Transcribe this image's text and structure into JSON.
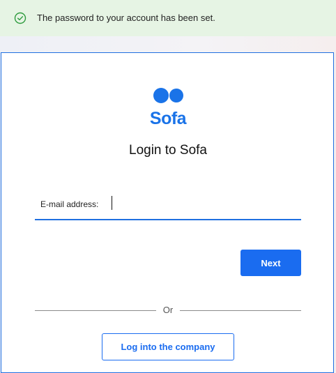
{
  "notification": {
    "icon": "check-circle-icon",
    "message": "The password to your account has been set.",
    "color": "#2e9b3e",
    "background": "#e6f4e4"
  },
  "brand": {
    "name": "Sofa",
    "logo_icon": "two-dots-logo-icon",
    "color": "#1a73e8"
  },
  "login": {
    "title": "Login to Sofa",
    "email_label": "E-mail address:",
    "email_value": "",
    "next_label": "Next",
    "divider_text": "Or",
    "company_label": "Log into the company"
  },
  "colors": {
    "accent": "#1a6cf0",
    "card_border": "#1f6fe0"
  }
}
